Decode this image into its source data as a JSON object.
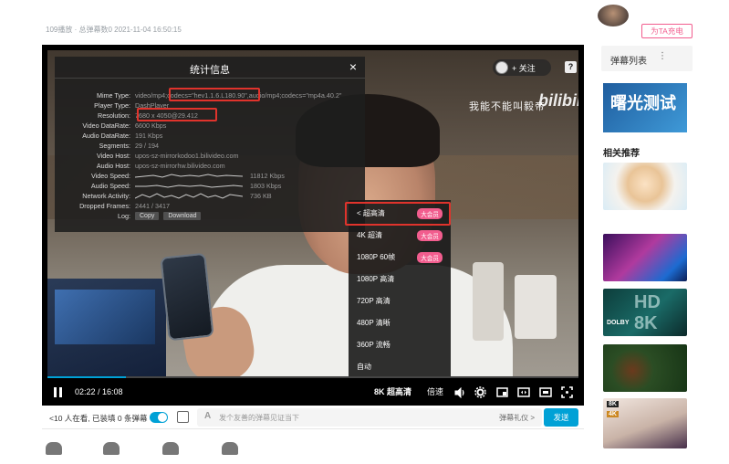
{
  "meta": {
    "text": "109播放 · 总弹幕数0   2021-11-04 16:50:15"
  },
  "header": {
    "follow_label": "+ 关注",
    "help_icon": "?"
  },
  "video": {
    "watermark_text": "我能不能叫毅帝",
    "watermark_logo": "bilibili"
  },
  "stats": {
    "title": "统计信息",
    "close_icon": "×",
    "rows": [
      {
        "label": "Mime Type:",
        "value": "video/mp4;codecs=\"hev1.1.6.L180.90\",audio/mp4;codecs=\"mp4a.40.2\""
      },
      {
        "label": "Player Type:",
        "value": "DashPlayer"
      },
      {
        "label": "Resolution:",
        "value": "7680 x 4050@29.412"
      },
      {
        "label": "Video DataRate:",
        "value": "6600 Kbps"
      },
      {
        "label": "Audio DataRate:",
        "value": "191 Kbps"
      },
      {
        "label": "Segments:",
        "value": "29 / 194"
      },
      {
        "label": "Video Host:",
        "value": "upos-sz-mirrorkodoo1.bilivideo.com"
      },
      {
        "label": "Audio Host:",
        "value": "upos-sz-mirrorhw.bilivideo.com"
      },
      {
        "label": "Video Speed:",
        "value": "11812 Kbps"
      },
      {
        "label": "Audio Speed:",
        "value": "1803 Kbps"
      },
      {
        "label": "Network Activity:",
        "value": "736 KB"
      },
      {
        "label": "Dropped Frames:",
        "value": "2441 / 3417"
      },
      {
        "label": "Log:",
        "value": ""
      }
    ],
    "log_copy": "Copy",
    "log_download": "Download"
  },
  "quality_menu": {
    "items": [
      {
        "label": "< 超高清",
        "badge": "大会员"
      },
      {
        "label": "4K 超清",
        "badge": "大会员"
      },
      {
        "label": "1080P 60帧",
        "badge": "大会员"
      },
      {
        "label": "1080P 高清",
        "badge": ""
      },
      {
        "label": "720P 高清",
        "badge": ""
      },
      {
        "label": "480P 清晰",
        "badge": ""
      },
      {
        "label": "360P 流畅",
        "badge": ""
      },
      {
        "label": "自动",
        "badge": ""
      }
    ]
  },
  "controls": {
    "time": "02:22 / 16:08",
    "quality": "8K 超高清",
    "speed": "倍速",
    "progress": 0.147
  },
  "send_bar": {
    "viewers": "<10 人在看, 已装填 0 条弹幕",
    "placeholder": "发个友善的弹幕见证当下",
    "etiquette": "弹幕礼仪 >",
    "send": "发送"
  },
  "sidebar": {
    "charge": "为TA充电",
    "danmaku_list": "弹幕列表",
    "danmaku_more": "⋮",
    "ad_title": "曙光测试",
    "related_title": "相关推荐",
    "thumb3_text": "HD 8K",
    "thumb3_dolby": "DOLBY",
    "thumb5_badge1": "8K",
    "thumb5_badge2": "4K"
  }
}
